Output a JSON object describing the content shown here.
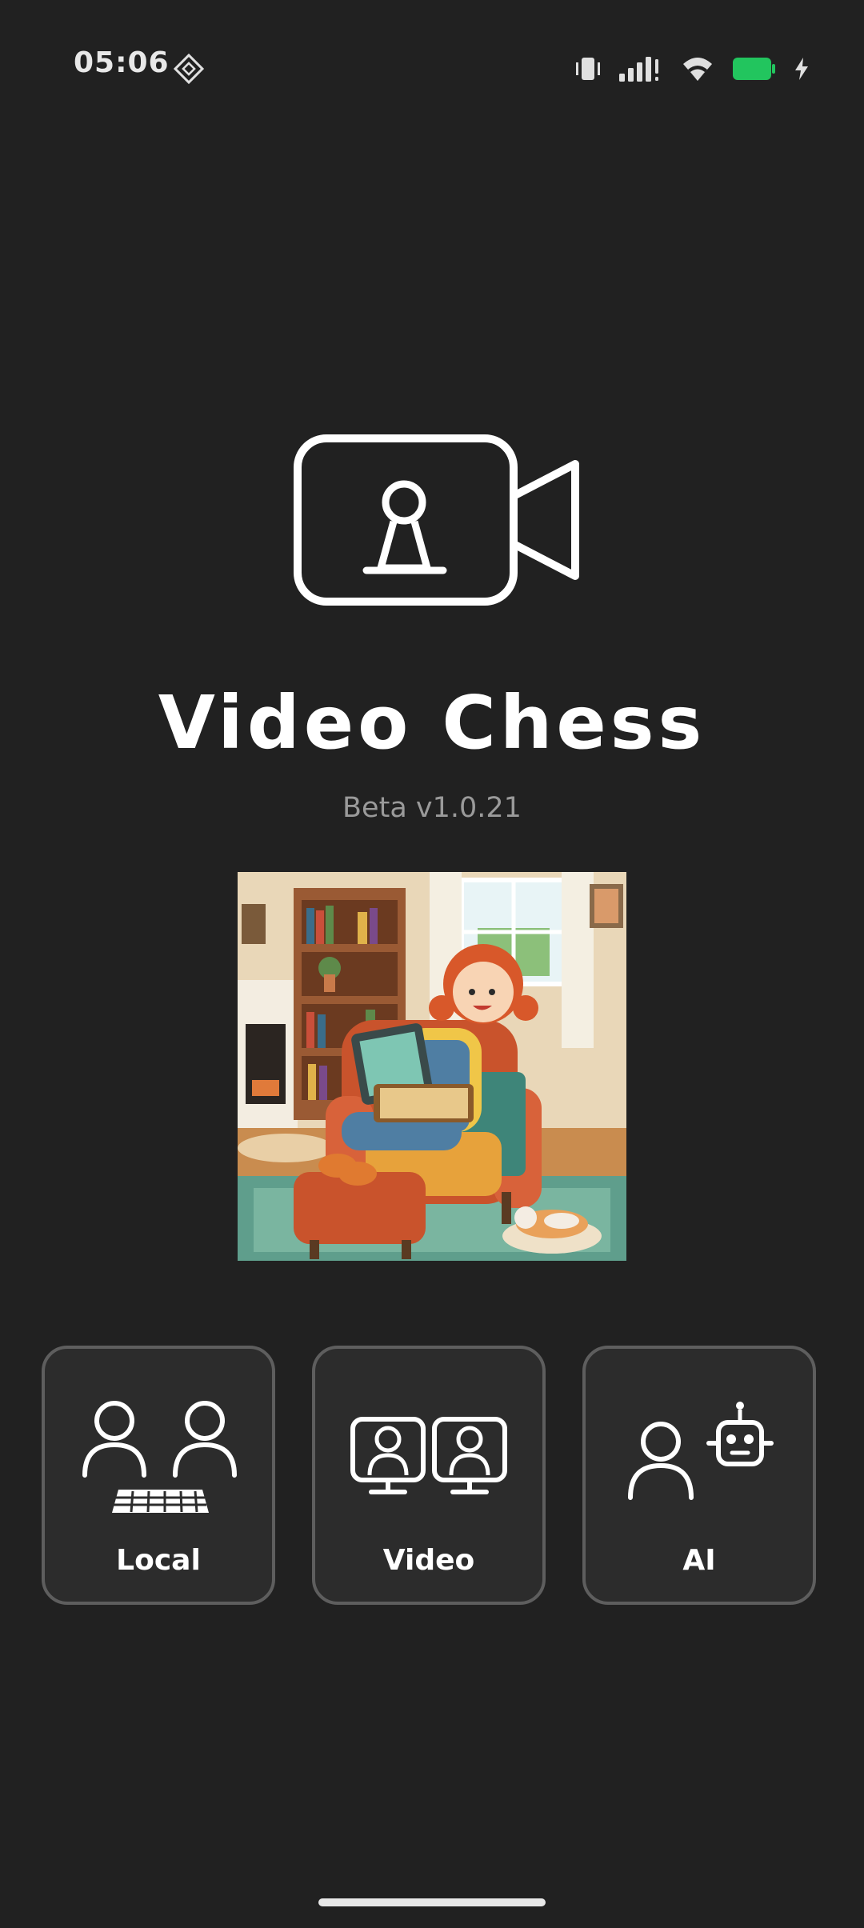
{
  "status_bar": {
    "time": "05:06",
    "left_icon": "location-diamond-icon",
    "icons": [
      "vibrate-icon",
      "signal-icon",
      "wifi-icon",
      "battery-icon",
      "charging-bolt-icon"
    ],
    "battery_color": "#22c55e"
  },
  "app": {
    "title": "Video Chess",
    "version": "Beta v1.0.21",
    "logo_icon": "video-camera-pawn-icon"
  },
  "illustration": {
    "icon": "girl-playing-chess-illustration"
  },
  "modes": [
    {
      "label": "Local",
      "icon": "two-players-keyboard-icon"
    },
    {
      "label": "Video",
      "icon": "two-monitors-players-icon"
    },
    {
      "label": "AI",
      "icon": "player-vs-robot-icon"
    }
  ],
  "colors": {
    "background": "#212121",
    "card_background": "#2c2c2c",
    "card_border": "#5e5e5e",
    "text_primary": "#ffffff",
    "text_secondary": "#9a9a9a"
  }
}
